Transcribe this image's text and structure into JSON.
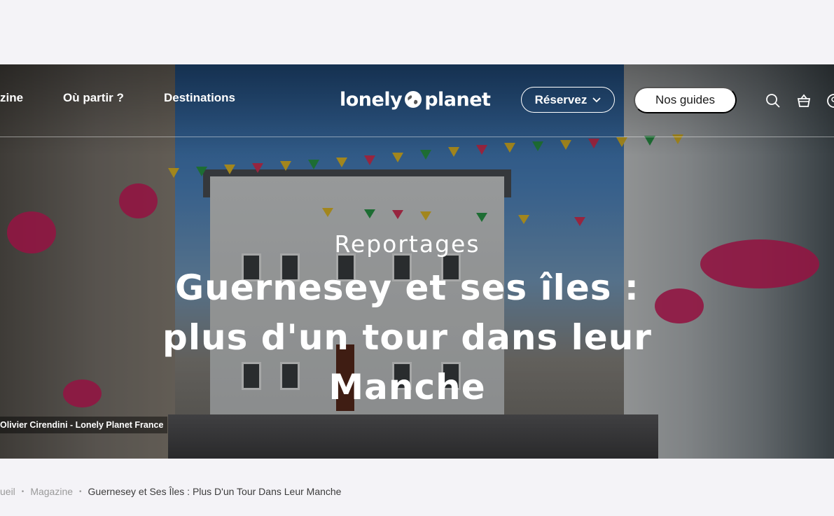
{
  "nav": {
    "magazine_label": "zine",
    "ou_partir_label": "Où partir ?",
    "destinations_label": "Destinations",
    "logo_text_left": "lonely",
    "logo_text_right": "planet",
    "reservez_label": "Réservez",
    "guides_label": "Nos guides",
    "icons": [
      "search-icon",
      "basket-icon",
      "account-icon"
    ]
  },
  "hero": {
    "kicker": "Reportages",
    "title": "Guernesey et ses îles : plus d'un tour dans leur Manche",
    "photo_credit": "Olivier Cirendini - Lonely Planet France"
  },
  "breadcrumb": {
    "items": [
      "ueil",
      "Magazine"
    ],
    "separator": "•",
    "current": "Guernesey et Ses Îles : Plus D'un Tour Dans Leur Manche"
  },
  "colors": {
    "page_bg": "#f4f3f7",
    "hero_text": "#ffffff",
    "button_bg": "#ffffff",
    "breadcrumb_text": "#9a9a9a",
    "breadcrumb_current": "#3b3b3b"
  }
}
